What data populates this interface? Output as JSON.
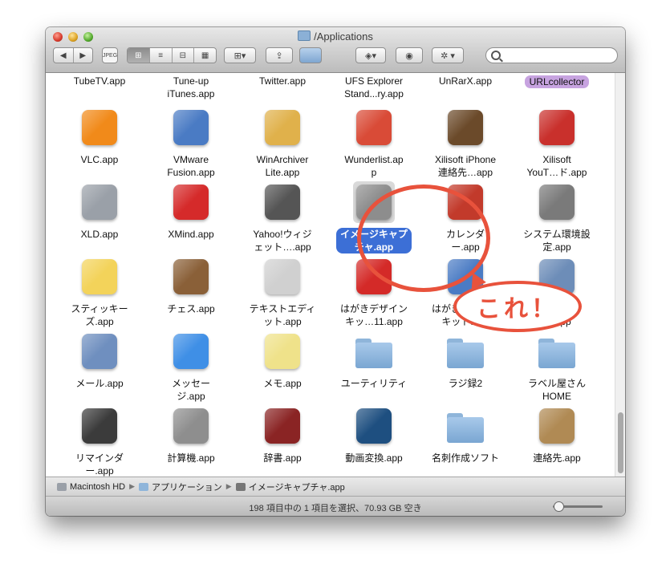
{
  "window": {
    "title": "/Applications"
  },
  "toolbar": {
    "nav_back": "◀",
    "nav_fwd": "▶",
    "view_icons": "⊞",
    "view_list": "≡",
    "view_columns": "⊟",
    "view_coverflow": "▦",
    "arrange": "▾",
    "share": "⇪",
    "dropbox": "▾",
    "quicklook": "◉",
    "action": "✲ ▾",
    "search_placeholder": ""
  },
  "toprow": [
    {
      "label": "TubeTV.app"
    },
    {
      "label": "Tune-up\niTunes.app"
    },
    {
      "label": "Twitter.app"
    },
    {
      "label": "UFS Explorer\nStand...ry.app"
    },
    {
      "label": "UnRarX.app"
    },
    {
      "label": "URLcollector"
    }
  ],
  "rows": [
    [
      {
        "label": "VLC.app",
        "icon": "vlc-cone-icon",
        "color": "#f18a1a"
      },
      {
        "label": "VMware\nFusion.app",
        "icon": "vmware-icon",
        "color": "#4a7bc4"
      },
      {
        "label": "WinArchiver\nLite.app",
        "icon": "winarchiver-icon",
        "color": "#e0b14b"
      },
      {
        "label": "Wunderlist.ap\np",
        "icon": "wunderlist-icon",
        "color": "#d94b37"
      },
      {
        "label": "Xilisoft iPhone\n連絡先…app",
        "icon": "address-book-icon",
        "color": "#6b4a2a"
      },
      {
        "label": "Xilisoft\nYouT…ド.app",
        "icon": "youtube-icon",
        "color": "#c9302c"
      }
    ],
    [
      {
        "label": "XLD.app",
        "icon": "xld-icon",
        "color": "#9aa0a8"
      },
      {
        "label": "XMind.app",
        "icon": "xmind-icon",
        "color": "#d52a2a"
      },
      {
        "label": "Yahoo!ウィジ\nェット….app",
        "icon": "widget-gear-icon",
        "color": "#555555"
      },
      {
        "label": "イメージキャプ\nチャ.app",
        "icon": "camera-icon",
        "color": "#8d8d8d",
        "selected": true
      },
      {
        "label": "カレンダ\nー.app",
        "icon": "calendar-icon",
        "color": "#c23a2b"
      },
      {
        "label": "システム環境設\n定.app",
        "icon": "system-prefs-gear-icon",
        "color": "#7a7a7a"
      }
    ],
    [
      {
        "label": "スティッキー\nズ.app",
        "icon": "stickies-icon",
        "color": "#f3d35a"
      },
      {
        "label": "チェス.app",
        "icon": "chess-knight-icon",
        "color": "#8a6038"
      },
      {
        "label": "テキストエディ\nット.app",
        "icon": "textedit-icon",
        "color": "#d0d0d0"
      },
      {
        "label": "はがきデザイン\nキッ…11.app",
        "icon": "hagaki-icon",
        "color": "#d42a28"
      },
      {
        "label": "はがきデザイン\nキット.app",
        "icon": "hagaki-kit-icon",
        "color": "#4a7bc4"
      },
      {
        "label": "プレビュ\nー.app",
        "icon": "preview-icon",
        "color": "#6d8db8"
      }
    ],
    [
      {
        "label": "メール.app",
        "icon": "mail-stamp-icon",
        "color": "#6f8fbf"
      },
      {
        "label": "メッセー\nジ.app",
        "icon": "messages-bubble-icon",
        "color": "#3f8fe6"
      },
      {
        "label": "メモ.app",
        "icon": "notes-icon",
        "color": "#efe28a"
      },
      {
        "label": "ユーティリティ",
        "icon": "utilities-folder-icon",
        "color": "#8fb5da",
        "folder": true
      },
      {
        "label": "ラジ録2",
        "icon": "folder-icon",
        "color": "#8fb5da",
        "folder": true
      },
      {
        "label": "ラベル屋さん\nHOME",
        "icon": "folder-icon",
        "color": "#8fb5da",
        "folder": true
      }
    ],
    [
      {
        "label": "リマインダ\nー.app",
        "icon": "reminders-icon",
        "color": "#3b3b3b"
      },
      {
        "label": "計算機.app",
        "icon": "calculator-icon",
        "color": "#8e8e8e"
      },
      {
        "label": "辞書.app",
        "icon": "dictionary-icon",
        "color": "#8a2424"
      },
      {
        "label": "動画変換.app",
        "icon": "video-convert-icon",
        "color": "#1e4f80"
      },
      {
        "label": "名刺作成ソフト",
        "icon": "folder-icon",
        "color": "#8fb5da",
        "folder": true
      },
      {
        "label": "連絡先.app",
        "icon": "contacts-icon",
        "color": "#b08a54"
      }
    ]
  ],
  "pathbar": {
    "items": [
      "Macintosh HD",
      "アプリケーション",
      "イメージキャプチャ.app"
    ]
  },
  "status": {
    "text": "198 項目中の 1 項目を選択、70.93 GB 空き"
  },
  "callout": {
    "text": "これ！"
  },
  "zoom_fraction": 0.1
}
